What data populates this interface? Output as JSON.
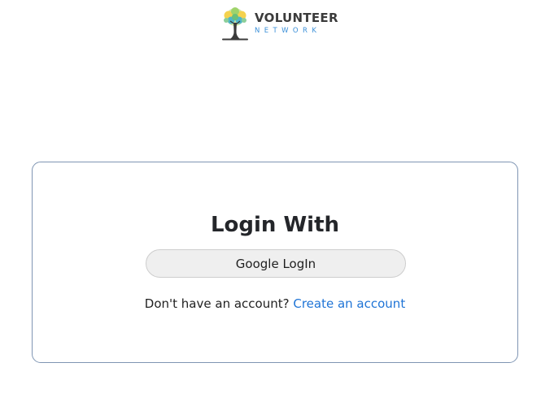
{
  "brand": {
    "name": "VOLUNTEER",
    "subtitle": "NETWORK",
    "colors": {
      "name": "#3b3b3b",
      "subtitle": "#3a8fd8"
    }
  },
  "login": {
    "title": "Login With",
    "google_button_label": "Google LogIn",
    "signup_prompt": "Don't have an account?",
    "signup_link_label": "Create an account"
  },
  "colors": {
    "card_border": "#7f95b3",
    "link": "#1f74d6",
    "button_bg": "#efefef"
  },
  "icons": {
    "logo": "tree-logo-icon"
  }
}
